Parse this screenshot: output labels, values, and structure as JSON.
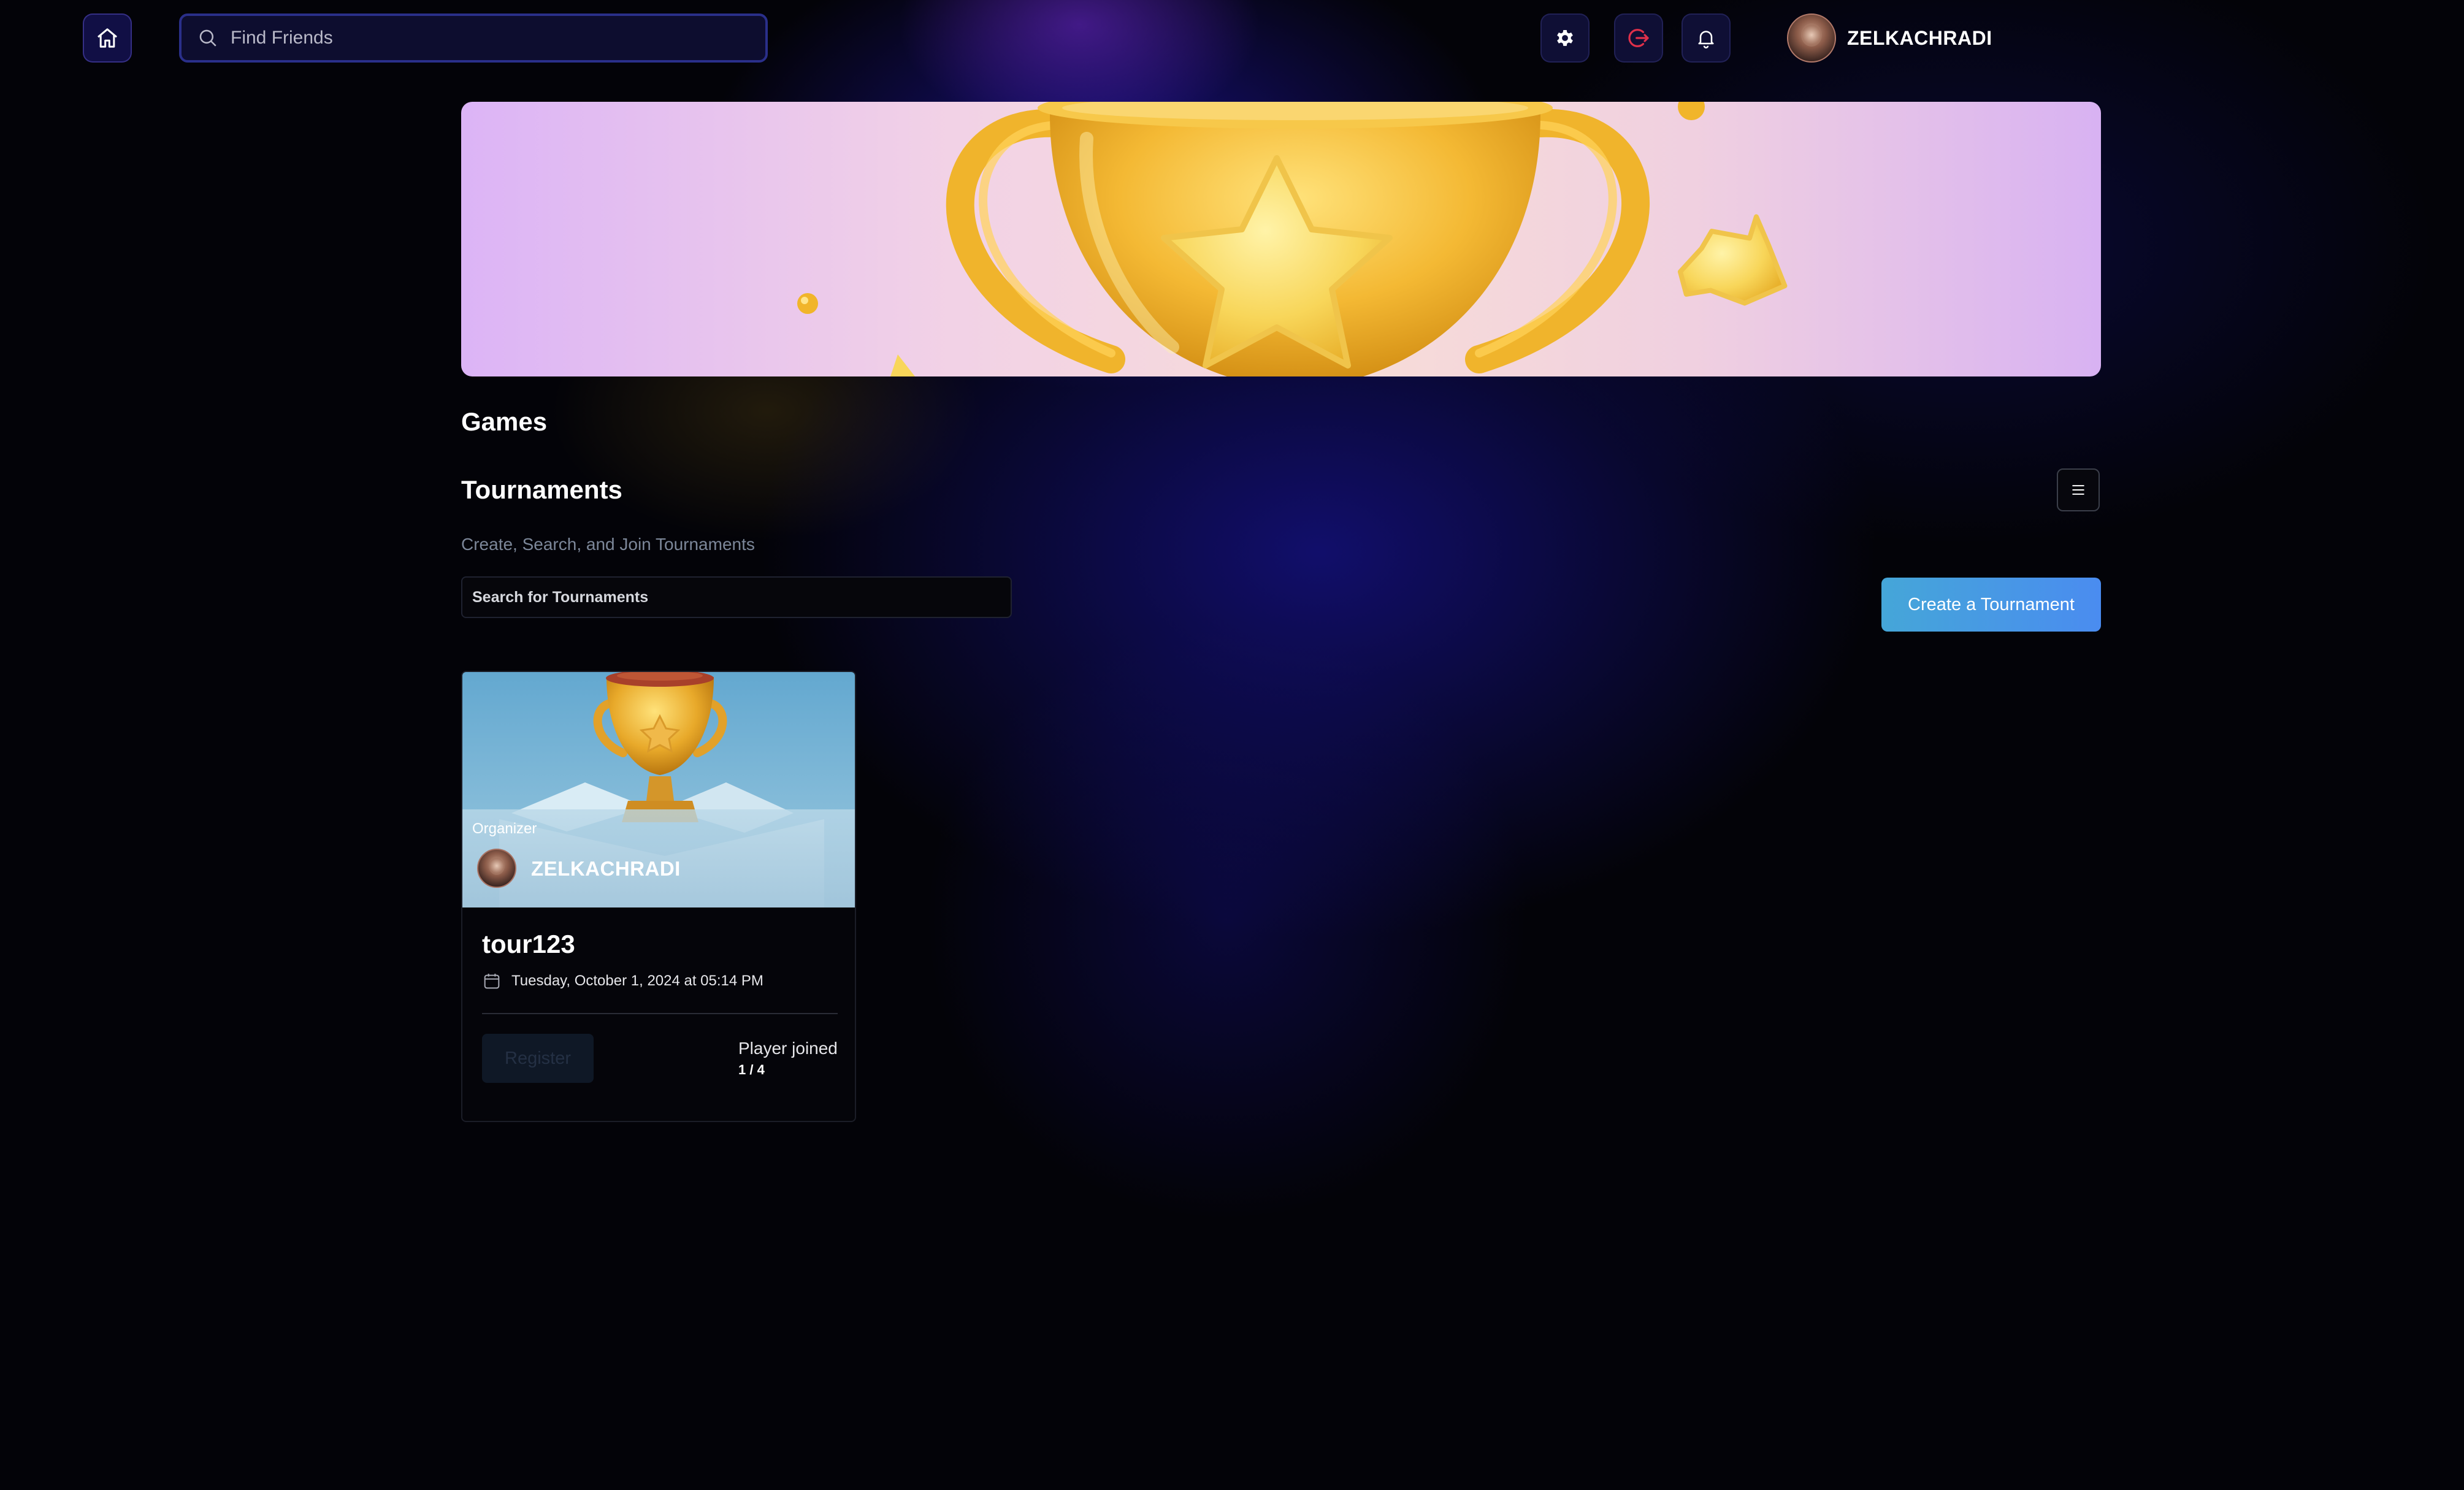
{
  "topbar": {
    "search_placeholder": "Find Friends",
    "profile_name": "ZELKACHRADI",
    "icons": {
      "home": "home-icon",
      "settings": "gear-icon",
      "logout": "logout-icon",
      "notifications": "bell-icon",
      "search": "search-icon"
    },
    "logout_color": "#e0304a"
  },
  "page": {
    "games_heading": "Games",
    "tournaments_heading": "Tournaments",
    "subtitle": "Create, Search, and Join Tournaments",
    "tournament_search_placeholder": "Search for Tournaments",
    "create_button": "Create a Tournament"
  },
  "tournaments": [
    {
      "organizer_label": "Organizer",
      "organizer_name": "ZELKACHRADI",
      "title": "tour123",
      "date": "Tuesday, October 1, 2024 at 05:14 PM",
      "register_label": "Register",
      "players_label": "Player joined",
      "players_count": "1 / 4"
    }
  ],
  "colors": {
    "accent_start": "#45a6d8",
    "accent_end": "#4a8cf0",
    "background": "#030308",
    "muted_text": "#7c8799"
  }
}
